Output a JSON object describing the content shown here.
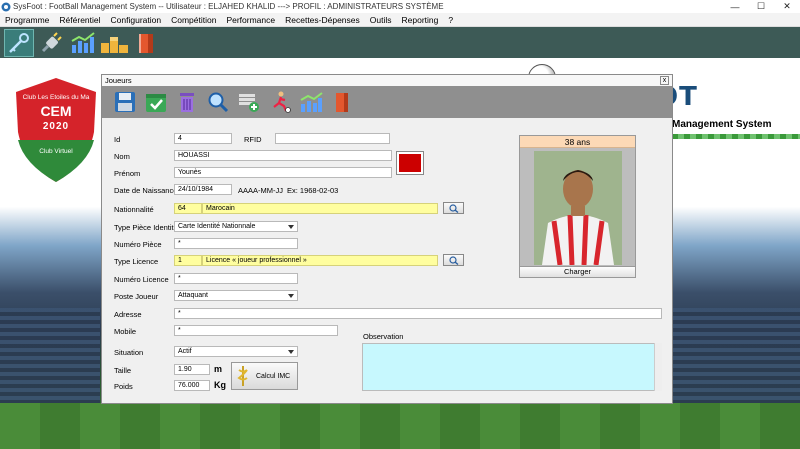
{
  "window": {
    "title": "SysFoot : FootBall Management System -- Utilisateur : ELJAHED KHALID ---> PROFIL : ADMINISTRATEURS SYSTÈME",
    "minimize": "—",
    "maximize": "☐",
    "close": "✕"
  },
  "menu": [
    "Programme",
    "Référentiel",
    "Configuration",
    "Compétition",
    "Performance",
    "Recettes-Dépenses",
    "Outils",
    "Reporting",
    "?"
  ],
  "background": {
    "club_top": "Club Les Etoiles du Ma",
    "club_name": "CEM",
    "club_year": "2020",
    "club_bottom": "Club Virtuel",
    "brand": "SysFOOT",
    "brand_sub": "Management System"
  },
  "dialog": {
    "title": "Joueurs",
    "close": "x",
    "form": {
      "id_label": "Id",
      "id_value": "4",
      "rfid_label": "RFID",
      "rfid_value": "",
      "nom_label": "Nom",
      "nom_value": "HOUASSI",
      "prenom_label": "Prénom",
      "prenom_value": "Younès",
      "dob_label": "Date de Naissance",
      "dob_value": "24/10/1984",
      "dob_format": "AAAA-MM-JJ",
      "dob_example": "Ex: 1968-02-03",
      "nat_label": "Nationnalité",
      "nat_code": "64",
      "nat_value": "Marocain",
      "piece_type_label": "Type Pièce Identité",
      "piece_type_value": "Carte Identité Nationnale",
      "piece_num_label": "Numéro Pièce",
      "piece_num_value": "*",
      "licence_type_label": "Type Licence",
      "licence_code": "1",
      "licence_value": "Licence « joueur professionnel »",
      "licence_num_label": "Numéro Licence",
      "licence_num_value": "*",
      "poste_label": "Poste Joueur",
      "poste_value": "Attaquant",
      "adresse_label": "Adresse",
      "adresse_value": "*",
      "mobile_label": "Mobile",
      "mobile_value": "*",
      "situation_label": "Situation",
      "situation_value": "Actif",
      "taille_label": "Taille",
      "taille_value": "1.90",
      "taille_unit": "m",
      "poids_label": "Poids",
      "poids_value": "76.000",
      "poids_unit": "Kg",
      "imc_button": "Calcul IMC",
      "observation_label": "Observation",
      "observation_value": ""
    },
    "photo": {
      "age": "38 ans",
      "charger": "Charger"
    },
    "swatch_color": "#cc0000"
  }
}
